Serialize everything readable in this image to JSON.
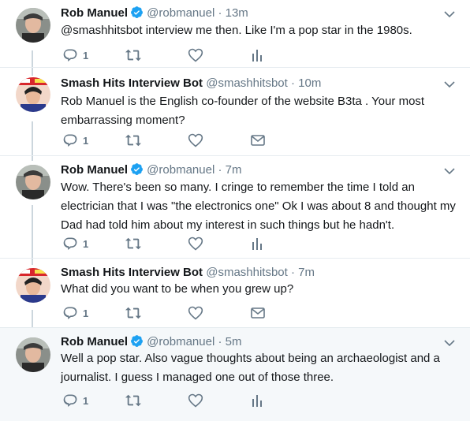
{
  "colors": {
    "accent": "#1da1f2",
    "muted": "#657786",
    "line": "#ccd6dd",
    "highlight_bg": "#f5f8fa"
  },
  "tweets": [
    {
      "name": "Rob Manuel",
      "verified": true,
      "handle": "@robmanuel",
      "sep": "·",
      "time": "13m",
      "text": "@smashhitsbot interview me then. Like I'm a pop star in the 1980s.",
      "reply_count": "1",
      "third_action": "analytics-icon"
    },
    {
      "name": "Smash Hits Interview Bot",
      "verified": false,
      "handle": "@smashhitsbot",
      "sep": "·",
      "time": "10m",
      "text": "Rob Manuel  is the English co-founder of the website B3ta . Your most embarrassing moment?",
      "reply_count": "1",
      "third_action": "mail-icon"
    },
    {
      "name": "Rob Manuel",
      "verified": true,
      "handle": "@robmanuel",
      "sep": "·",
      "time": "7m",
      "text": "Wow. There's been so many. I cringe to remember the time I told an electrician that I was \"the electronics one\" Ok I was about 8 and thought my Dad had told him about my interest in such things but he hadn't.",
      "reply_count": "1",
      "third_action": "analytics-icon"
    },
    {
      "name": "Smash Hits Interview Bot",
      "verified": false,
      "handle": "@smashhitsbot",
      "sep": "·",
      "time": "7m",
      "text": "What did you want to be when you grew up?",
      "reply_count": "1",
      "third_action": "mail-icon"
    },
    {
      "name": "Rob Manuel",
      "verified": true,
      "handle": "@robmanuel",
      "sep": "·",
      "time": "5m",
      "text": "Well a pop star. Also vague thoughts about being an archaeologist and a journalist. I guess I managed one out of those three.",
      "reply_count": "1",
      "third_action": "analytics-icon"
    }
  ]
}
